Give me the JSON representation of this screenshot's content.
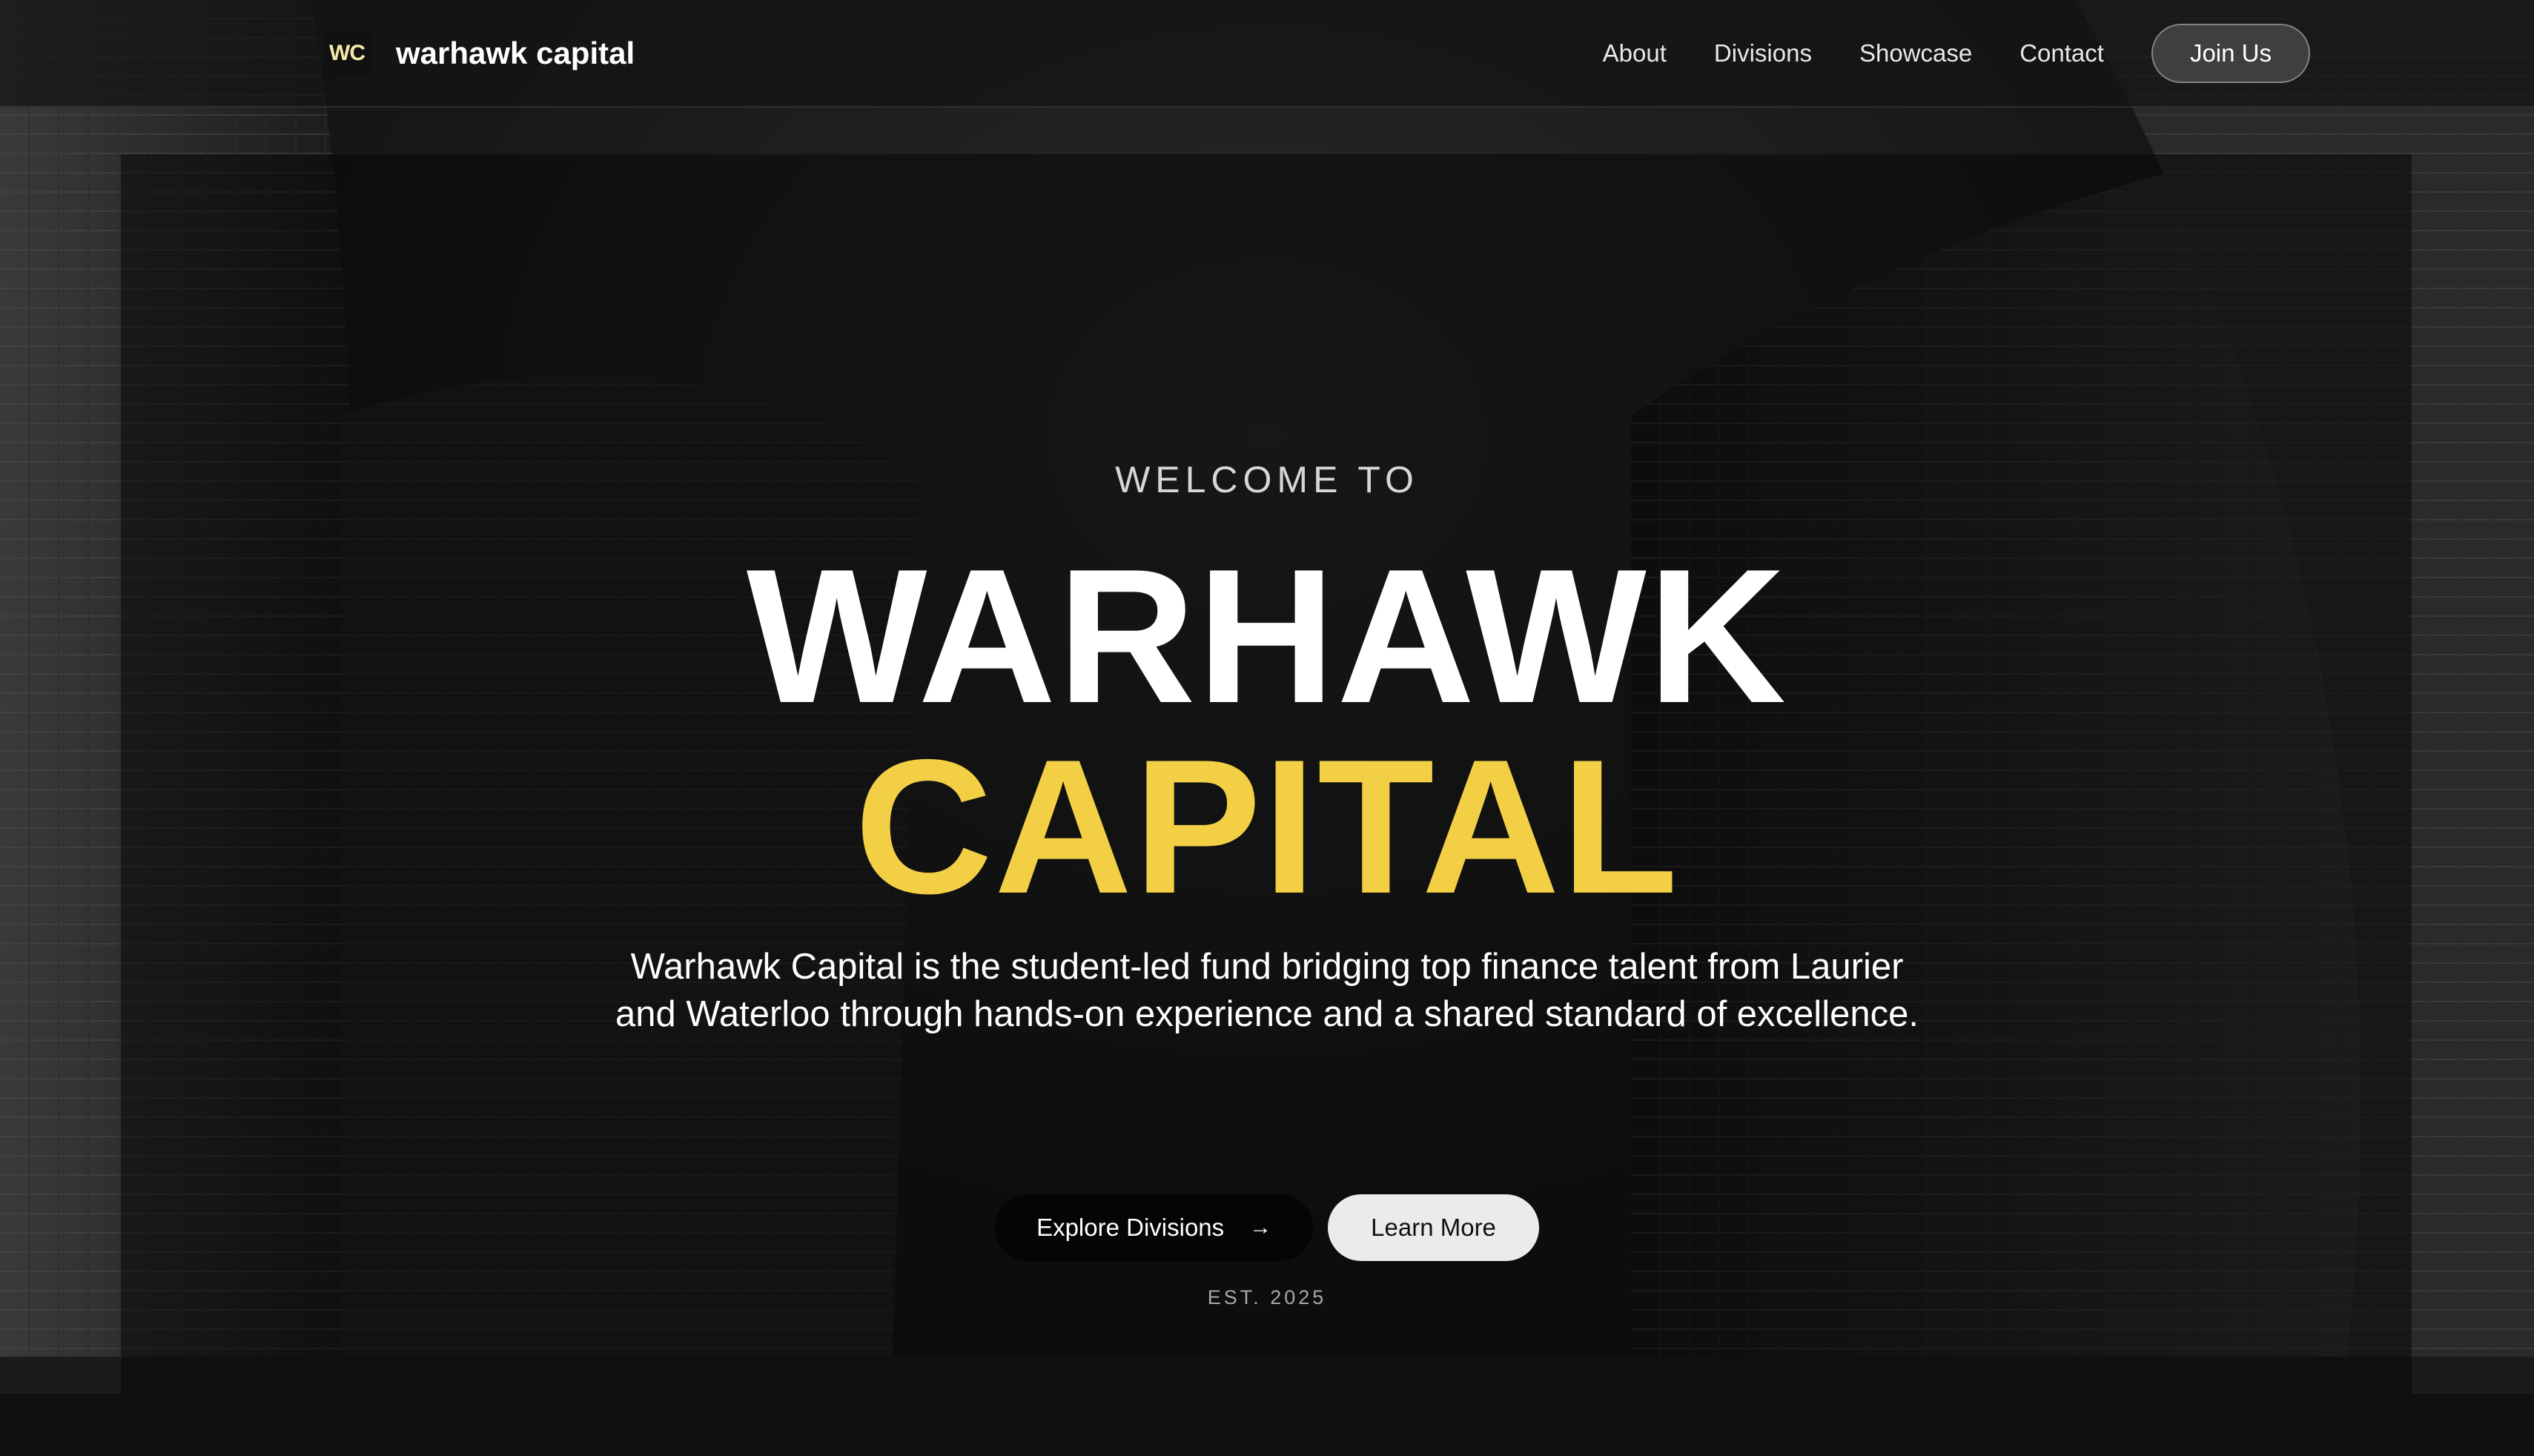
{
  "nav": {
    "logo_text": "WC",
    "brand_name": "warhawk capital",
    "links": [
      "About",
      "Divisions",
      "Showcase",
      "Contact"
    ],
    "join_label": "Join Us"
  },
  "hero": {
    "welcome": "WELCOME TO",
    "title_line1": "WARHAWK",
    "title_line2": "CAPITAL",
    "description": "Warhawk Capital is the student-led fund bridging top finance talent from Laurier and Waterloo through hands-on experience and a shared standard of excellence.",
    "primary_cta": "Explore Divisions",
    "primary_cta_icon": "arrow-right-icon",
    "secondary_cta": "Learn More",
    "established": "EST. 2025"
  },
  "colors": {
    "accent": "#f2cf45",
    "text": "#ffffff",
    "background": "#0b0b0b"
  }
}
